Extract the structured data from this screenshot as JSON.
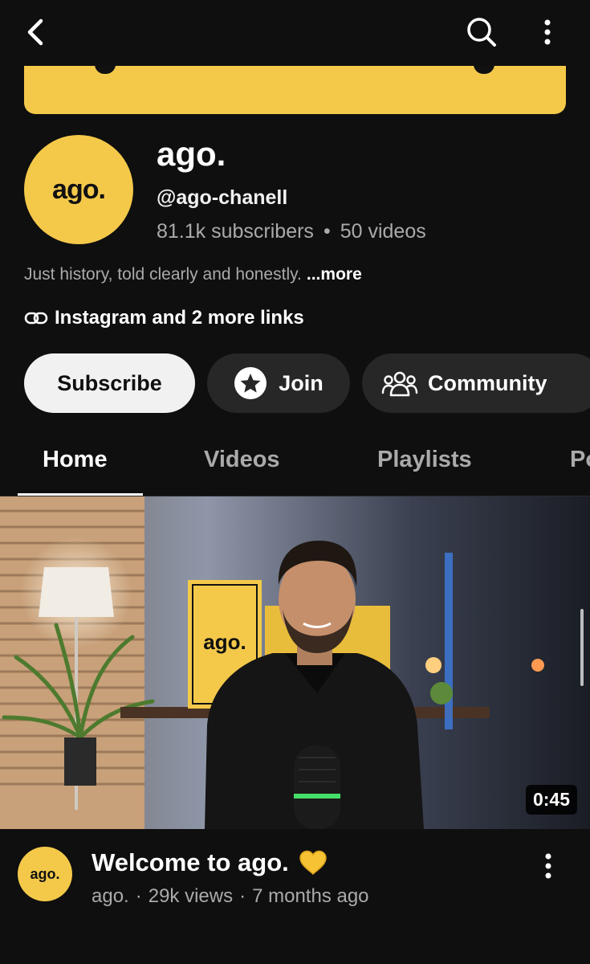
{
  "channel": {
    "name": "ago.",
    "avatar_text": "ago.",
    "handle": "@ago-chanell",
    "subscribers": "81.1k subscribers",
    "separator": "•",
    "videos": "50 videos",
    "description": "Just history, told clearly and honestly.",
    "more_label": "...more",
    "links_label": "Instagram and 2 more links"
  },
  "actions": {
    "subscribe": "Subscribe",
    "join": "Join",
    "community": "Community"
  },
  "tabs": [
    {
      "label": "Home",
      "active": true
    },
    {
      "label": "Videos",
      "active": false
    },
    {
      "label": "Playlists",
      "active": false
    },
    {
      "label": "Po",
      "active": false
    }
  ],
  "featured_video": {
    "duration": "0:45",
    "title": "Welcome to ago.",
    "title_emoji": "yellow-heart",
    "avatar_text": "ago.",
    "channel": "ago.",
    "separator": "·",
    "views": "29k views",
    "age": "7 months ago",
    "poster_text": "ago."
  },
  "colors": {
    "background": "#0f0f0f",
    "brand_yellow": "#f4c94a",
    "pill_dark": "#272727",
    "subscribe_bg": "#f1f1f1",
    "secondary_text": "#aaaaaa"
  },
  "icons": [
    "back-icon",
    "search-icon",
    "more-vert-icon",
    "link-icon",
    "star-icon",
    "community-icon",
    "yellow-heart-icon"
  ]
}
